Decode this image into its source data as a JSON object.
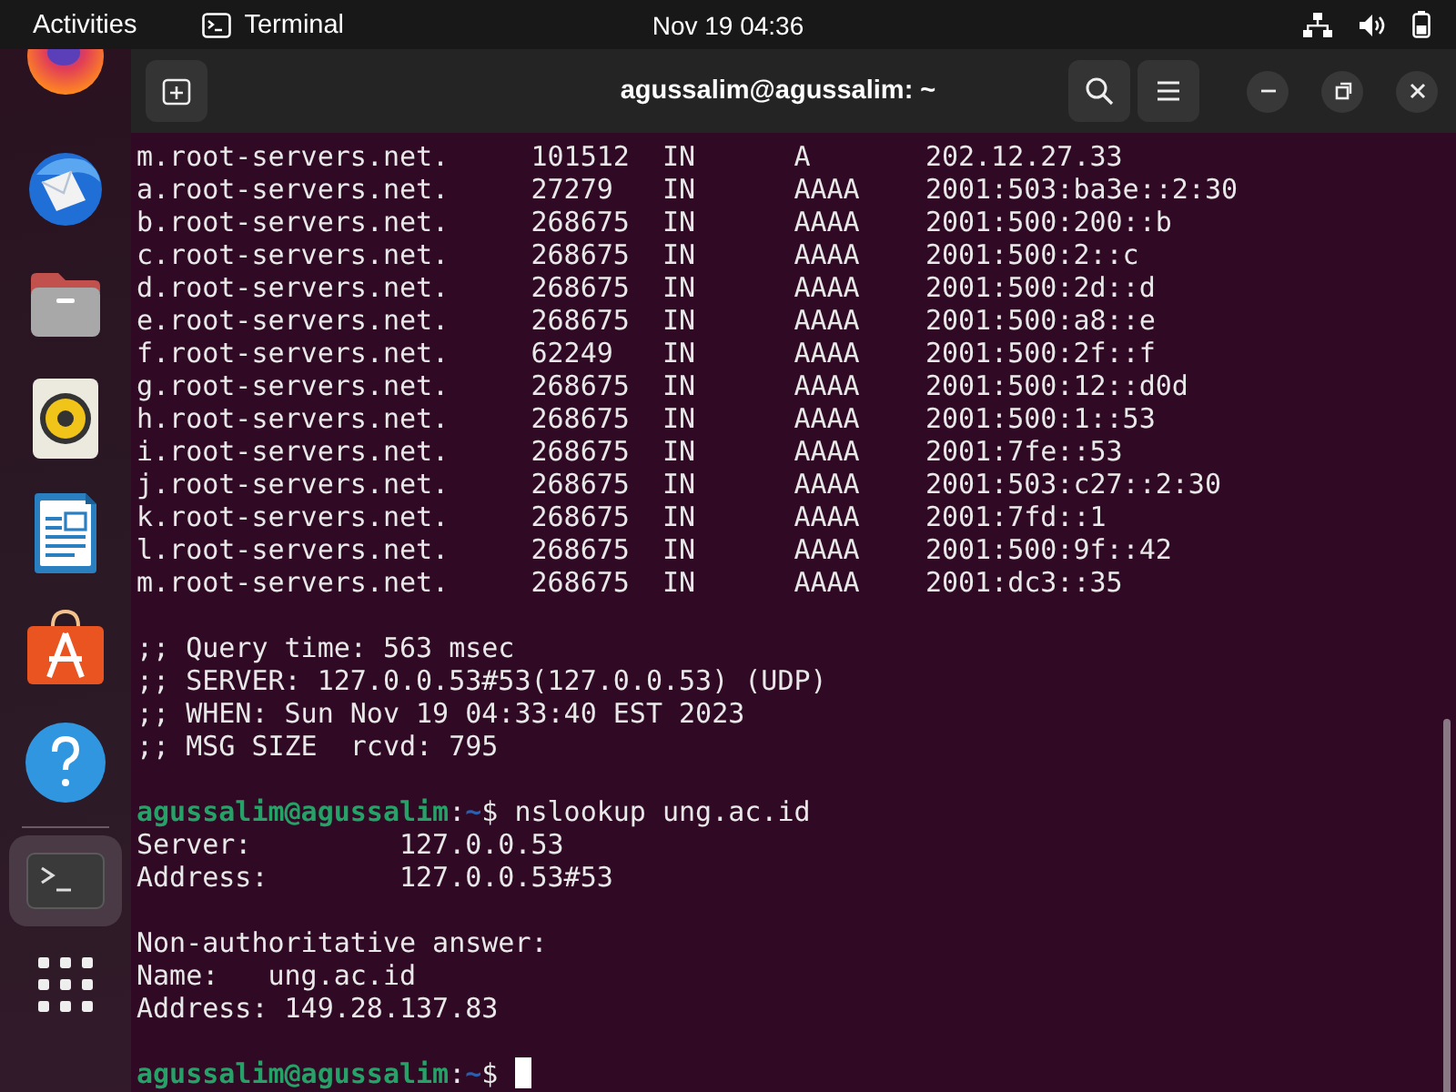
{
  "top_bar": {
    "activities": "Activities",
    "app_name": "Terminal",
    "clock": "Nov 19  04:36"
  },
  "dock": {
    "items": [
      {
        "kind": "firefox",
        "selected": false
      },
      {
        "kind": "mail",
        "selected": false
      },
      {
        "kind": "files",
        "selected": false
      },
      {
        "kind": "music",
        "selected": false
      },
      {
        "kind": "writer",
        "selected": false
      },
      {
        "kind": "store",
        "selected": false
      },
      {
        "kind": "help",
        "selected": false
      },
      {
        "kind": "separator"
      },
      {
        "kind": "terminal",
        "selected": true
      },
      {
        "kind": "apps",
        "selected": false
      }
    ]
  },
  "window": {
    "title": "agussalim@agussalim: ~"
  },
  "terminal": {
    "lines": [
      {
        "kind": "record",
        "name": "m.root-servers.net.",
        "ttl": "101512",
        "class": "IN",
        "type": "A",
        "data": "202.12.27.33"
      },
      {
        "kind": "record",
        "name": "a.root-servers.net.",
        "ttl": "27279",
        "class": "IN",
        "type": "AAAA",
        "data": "2001:503:ba3e::2:30"
      },
      {
        "kind": "record",
        "name": "b.root-servers.net.",
        "ttl": "268675",
        "class": "IN",
        "type": "AAAA",
        "data": "2001:500:200::b"
      },
      {
        "kind": "record",
        "name": "c.root-servers.net.",
        "ttl": "268675",
        "class": "IN",
        "type": "AAAA",
        "data": "2001:500:2::c"
      },
      {
        "kind": "record",
        "name": "d.root-servers.net.",
        "ttl": "268675",
        "class": "IN",
        "type": "AAAA",
        "data": "2001:500:2d::d"
      },
      {
        "kind": "record",
        "name": "e.root-servers.net.",
        "ttl": "268675",
        "class": "IN",
        "type": "AAAA",
        "data": "2001:500:a8::e"
      },
      {
        "kind": "record",
        "name": "f.root-servers.net.",
        "ttl": "62249",
        "class": "IN",
        "type": "AAAA",
        "data": "2001:500:2f::f"
      },
      {
        "kind": "record",
        "name": "g.root-servers.net.",
        "ttl": "268675",
        "class": "IN",
        "type": "AAAA",
        "data": "2001:500:12::d0d"
      },
      {
        "kind": "record",
        "name": "h.root-servers.net.",
        "ttl": "268675",
        "class": "IN",
        "type": "AAAA",
        "data": "2001:500:1::53"
      },
      {
        "kind": "record",
        "name": "i.root-servers.net.",
        "ttl": "268675",
        "class": "IN",
        "type": "AAAA",
        "data": "2001:7fe::53"
      },
      {
        "kind": "record",
        "name": "j.root-servers.net.",
        "ttl": "268675",
        "class": "IN",
        "type": "AAAA",
        "data": "2001:503:c27::2:30"
      },
      {
        "kind": "record",
        "name": "k.root-servers.net.",
        "ttl": "268675",
        "class": "IN",
        "type": "AAAA",
        "data": "2001:7fd::1"
      },
      {
        "kind": "record",
        "name": "l.root-servers.net.",
        "ttl": "268675",
        "class": "IN",
        "type": "AAAA",
        "data": "2001:500:9f::42"
      },
      {
        "kind": "record",
        "name": "m.root-servers.net.",
        "ttl": "268675",
        "class": "IN",
        "type": "AAAA",
        "data": "2001:dc3::35"
      },
      {
        "kind": "blank"
      },
      {
        "kind": "text",
        "text": ";; Query time: 563 msec"
      },
      {
        "kind": "text",
        "text": ";; SERVER: 127.0.0.53#53(127.0.0.53) (UDP)"
      },
      {
        "kind": "text",
        "text": ";; WHEN: Sun Nov 19 04:33:40 EST 2023"
      },
      {
        "kind": "text",
        "text": ";; MSG SIZE  rcvd: 795"
      },
      {
        "kind": "blank"
      },
      {
        "kind": "prompt",
        "user_host": "agussalim@agussalim",
        "separator": ":",
        "path": "~",
        "symbol": "$",
        "command": "nslookup ung.ac.id",
        "cursor": false
      },
      {
        "kind": "text",
        "text": "Server:         127.0.0.53"
      },
      {
        "kind": "text",
        "text": "Address:        127.0.0.53#53"
      },
      {
        "kind": "blank"
      },
      {
        "kind": "text",
        "text": "Non-authoritative answer:"
      },
      {
        "kind": "text",
        "text": "Name:   ung.ac.id"
      },
      {
        "kind": "text",
        "text": "Address: 149.28.137.83"
      },
      {
        "kind": "blank"
      },
      {
        "kind": "prompt",
        "user_host": "agussalim@agussalim",
        "separator": ":",
        "path": "~",
        "symbol": "$",
        "cursor": true
      }
    ]
  }
}
